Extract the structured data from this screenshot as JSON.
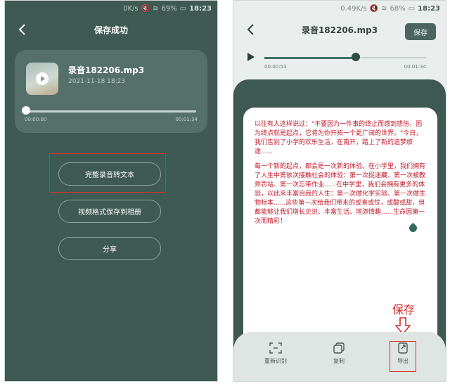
{
  "left_screen": {
    "status": {
      "speed": "0K/s",
      "battery": "69%",
      "time": "18:23"
    },
    "title": "保存成功",
    "file": {
      "name": "录音182206.mp3",
      "date": "2021-11-18 18:23"
    },
    "player": {
      "current": "00:00:00",
      "total": "00:01:34",
      "progress": 0.0
    },
    "actions": [
      "完整录音转文本",
      "视频格式保存到相册",
      "分享"
    ]
  },
  "right_screen": {
    "status": {
      "speed": "0.49K/s",
      "battery": "68%",
      "time": "18:23"
    },
    "title": "录音182206.mp3",
    "save_label": "保存",
    "player": {
      "current": "00:00:53",
      "total": "00:01:34",
      "progress": 0.56
    },
    "transcript": [
      "以往有人这样说过：\"不要因为一件事的终止而感到悲伤，因为终点就是起点，它将为你开拓一个更广阔的世界。\"今日，我们告别了小学的欢乐生活，在南开，踏上了新的追梦旅途......",
      "每一个新的起点，都会是一次新的体验。在小学里，我们拥有了人生中第依次接触社会的体验：第一次捉迷藏、第一次被教师罚站、第一次忘带作业......在中学里，我们会拥有更多的体验，以此来丰富自我的人生：第一次做化学实验、第一次做生物标本......这些第一次给我们带来的或喜或忧，或酸或甜，但都能够让我们增长见识、丰富生活、增添情趣......生命因第一次而精彩！"
    ],
    "annotation": "保存",
    "bottom": [
      "重新识别",
      "复制",
      "导出"
    ]
  },
  "colors": {
    "primary": "#3f5a52",
    "highlight": "#d9302f",
    "text_red": "#c2192b"
  }
}
